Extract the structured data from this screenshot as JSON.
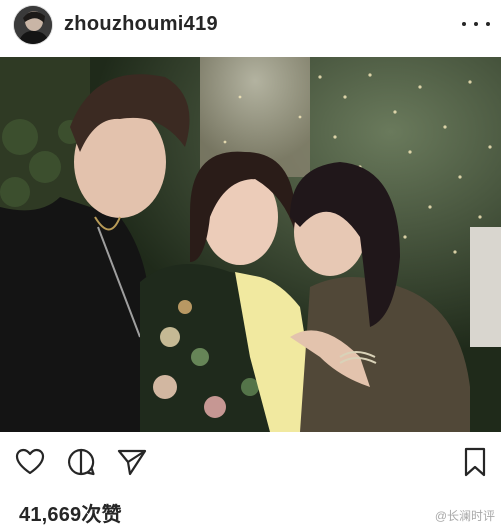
{
  "post": {
    "username": "zhouzhoumi419",
    "likes_text": "41,669次赞",
    "watermark": "@长澜时评"
  },
  "icons": {
    "avatar": "user-avatar",
    "more": "more-options-icon",
    "like": "heart-icon",
    "comment": "comment-icon",
    "share": "paper-plane-icon",
    "save": "bookmark-icon"
  },
  "colors": {
    "text": "#262626",
    "icon_stroke": "#262626",
    "background": "#ffffff"
  }
}
